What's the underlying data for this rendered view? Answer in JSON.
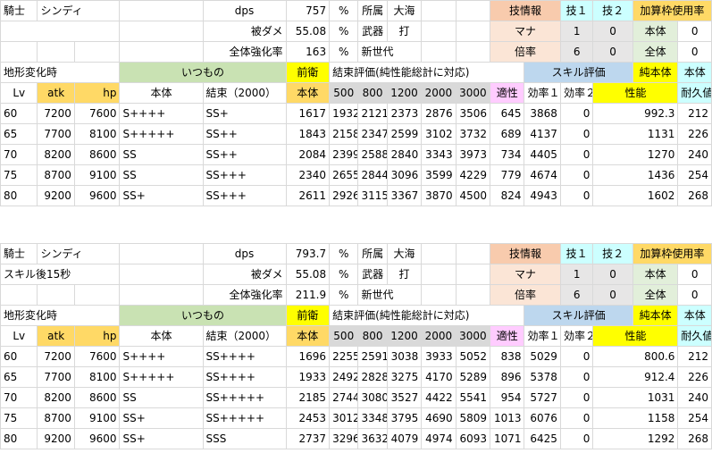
{
  "blocks": [
    {
      "header": {
        "class_name": "騎士",
        "char_name": "シンディ",
        "dps_label": "dps",
        "dps_value": "757",
        "pct": "%",
        "affil_label": "所属",
        "affil_value": "大海",
        "skill_info": "技情報",
        "skill1": "技１",
        "skill2": "技２",
        "bonus": "加算枠使用率"
      },
      "row2": {
        "note": "",
        "dmg_label": "被ダメ",
        "dmg_value": "55.08",
        "pct": "%",
        "weapon_label": "武器",
        "weapon_value": "打",
        "mana_label": "マナ",
        "mana1": "1",
        "mana2": "0",
        "body_label": "本体",
        "body_value": "0"
      },
      "row3": {
        "boost_label": "全体強化率",
        "boost_value": "163",
        "pct": "%",
        "gen_value": "新世代",
        "rate_label": "倍率",
        "rate1": "6",
        "rate2": "0",
        "all_label": "全体",
        "all_value": "0"
      },
      "row4": {
        "terrain": "地形変化時",
        "usual": "いつもの",
        "front": "前衛",
        "bond_eval": "結束評価(純性能総計に対応)",
        "skill_eval": "スキル評価",
        "pure_body": "純本体",
        "body_col": "本体"
      },
      "row5": {
        "lv": "Lv",
        "atk": "atk",
        "hp": "hp",
        "hontai": "本体",
        "bond": "結束（2000）",
        "body": "本体",
        "b500": "500",
        "b800": "800",
        "b1200": "1200",
        "b2000": "2000",
        "b3000": "3000",
        "apt": "適性",
        "eff1": "効率１",
        "eff2": "効率２",
        "perf": "性能",
        "dur": "耐久値"
      },
      "rows": [
        [
          "60",
          "7200",
          "7600",
          "S++++",
          "SS+",
          "1617",
          "1932",
          "2121",
          "2373",
          "2876",
          "3506",
          "645",
          "3868",
          "0",
          "992.3",
          "212"
        ],
        [
          "65",
          "7700",
          "8100",
          "S+++++",
          "SS++",
          "1843",
          "2158",
          "2347",
          "2599",
          "3102",
          "3732",
          "689",
          "4137",
          "0",
          "1131",
          "226"
        ],
        [
          "70",
          "8200",
          "8600",
          "SS",
          "SS++",
          "2084",
          "2399",
          "2588",
          "2840",
          "3343",
          "3973",
          "734",
          "4405",
          "0",
          "1270",
          "240"
        ],
        [
          "75",
          "8700",
          "9100",
          "SS",
          "SS+++",
          "2340",
          "2655",
          "2844",
          "3096",
          "3599",
          "4229",
          "779",
          "4674",
          "0",
          "1436",
          "254"
        ],
        [
          "80",
          "9200",
          "9600",
          "SS+",
          "SS+++",
          "2611",
          "2926",
          "3115",
          "3367",
          "3870",
          "4500",
          "824",
          "4943",
          "0",
          "1602",
          "268"
        ]
      ]
    },
    {
      "header": {
        "class_name": "騎士",
        "char_name": "シンディ",
        "dps_label": "dps",
        "dps_value": "793.7",
        "pct": "%",
        "affil_label": "所属",
        "affil_value": "大海",
        "skill_info": "技情報",
        "skill1": "技１",
        "skill2": "技２",
        "bonus": "加算枠使用率"
      },
      "row2": {
        "note": "スキル後15秒",
        "dmg_label": "被ダメ",
        "dmg_value": "55.08",
        "pct": "%",
        "weapon_label": "武器",
        "weapon_value": "打",
        "mana_label": "マナ",
        "mana1": "1",
        "mana2": "0",
        "body_label": "本体",
        "body_value": "0"
      },
      "row3": {
        "boost_label": "全体強化率",
        "boost_value": "211.9",
        "pct": "%",
        "gen_value": "新世代",
        "rate_label": "倍率",
        "rate1": "6",
        "rate2": "0",
        "all_label": "全体",
        "all_value": "0"
      },
      "row4": {
        "terrain": "地形変化時",
        "usual": "いつもの",
        "front": "前衛",
        "bond_eval": "結束評価(純性能総計に対応)",
        "skill_eval": "スキル評価",
        "pure_body": "純本体",
        "body_col": "本体"
      },
      "row5": {
        "lv": "Lv",
        "atk": "atk",
        "hp": "hp",
        "hontai": "本体",
        "bond": "結束（2000）",
        "body": "本体",
        "b500": "500",
        "b800": "800",
        "b1200": "1200",
        "b2000": "2000",
        "b3000": "3000",
        "apt": "適性",
        "eff1": "効率１",
        "eff2": "効率２",
        "perf": "性能",
        "dur": "耐久値"
      },
      "rows": [
        [
          "60",
          "7200",
          "7600",
          "S++++",
          "SS++++",
          "1696",
          "2255",
          "2591",
          "3038",
          "3933",
          "5052",
          "838",
          "5029",
          "0",
          "800.6",
          "212"
        ],
        [
          "65",
          "7700",
          "8100",
          "S+++++",
          "SS++++",
          "1933",
          "2492",
          "2828",
          "3275",
          "4170",
          "5289",
          "896",
          "5378",
          "0",
          "912.4",
          "226"
        ],
        [
          "70",
          "8200",
          "8600",
          "SS",
          "SS+++++",
          "2185",
          "2744",
          "3080",
          "3527",
          "4422",
          "5541",
          "954",
          "5727",
          "0",
          "1031",
          "240"
        ],
        [
          "75",
          "8700",
          "9100",
          "SS+",
          "SS+++++",
          "2453",
          "3012",
          "3348",
          "3795",
          "4690",
          "5809",
          "1013",
          "6076",
          "0",
          "1158",
          "254"
        ],
        [
          "80",
          "9200",
          "9600",
          "SS+",
          "SSS",
          "2737",
          "3296",
          "3632",
          "4079",
          "4974",
          "6093",
          "1071",
          "6425",
          "0",
          "1292",
          "268"
        ]
      ]
    }
  ]
}
